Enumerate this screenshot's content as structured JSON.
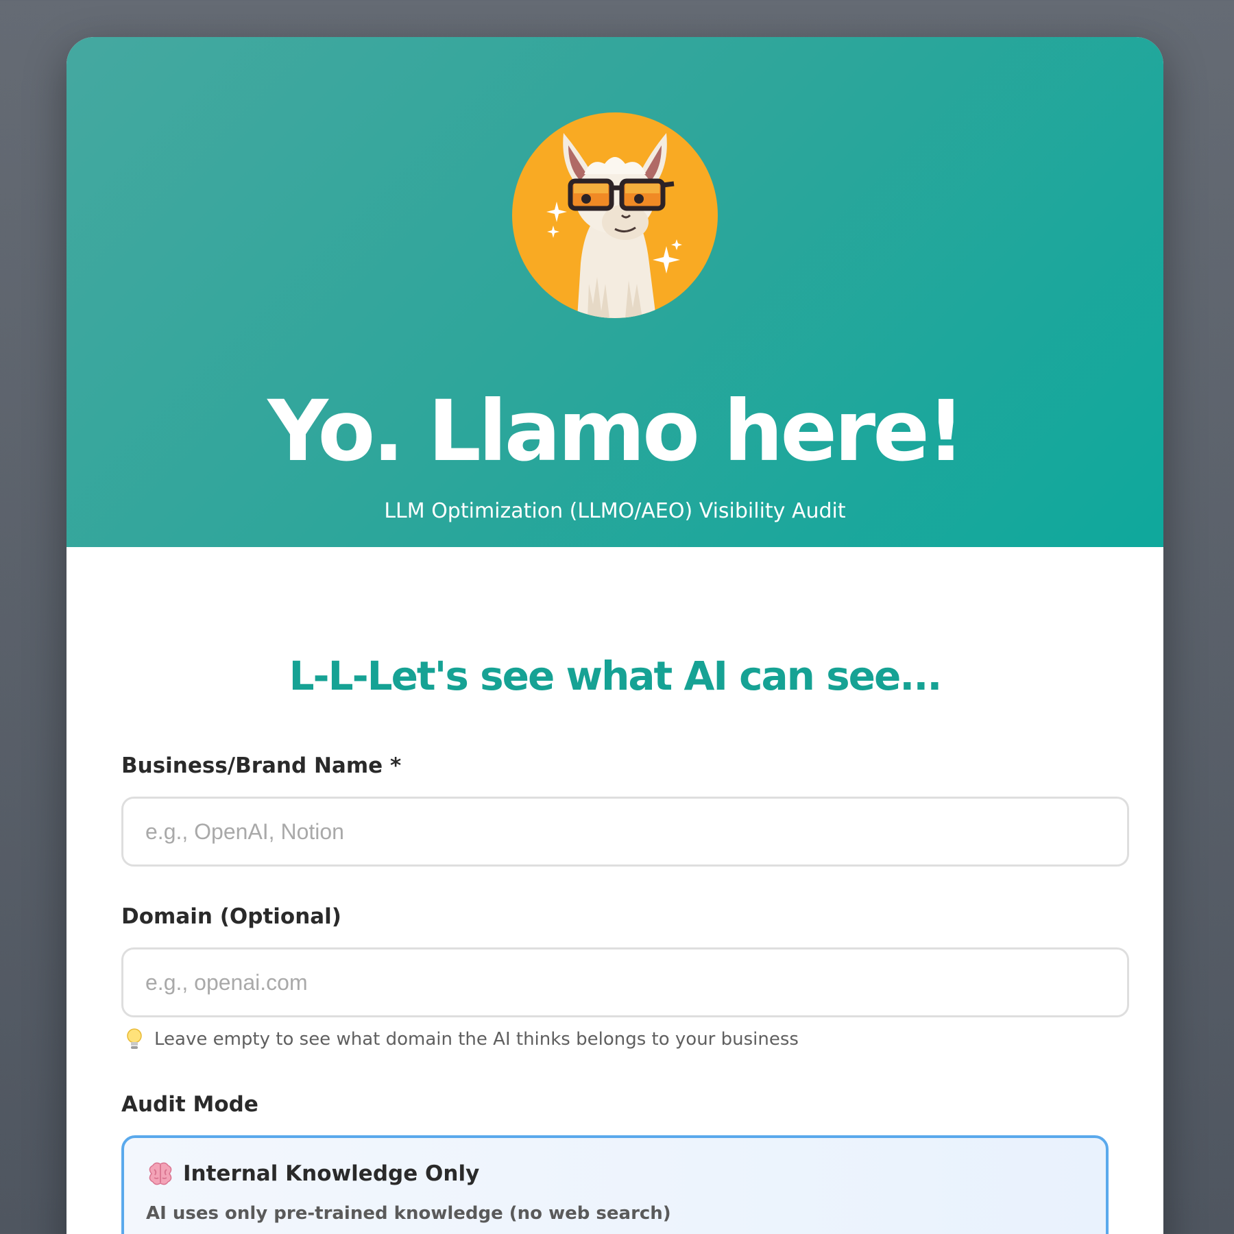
{
  "header": {
    "logo_icon": "llama-with-sunglasses-icon",
    "title": "Yo. Llamo here!",
    "subtitle": "LLM Optimization (LLMO/AEO) Visibility Audit"
  },
  "form": {
    "heading": "L-L-Let's see what AI can see...",
    "business_name": {
      "label": "Business/Brand Name *",
      "value": "",
      "placeholder": "e.g., OpenAI, Notion"
    },
    "domain": {
      "label": "Domain (Optional)",
      "value": "",
      "placeholder": "e.g., openai.com",
      "hint_icon": "lightbulb-icon",
      "hint": "Leave empty to see what domain the AI thinks belongs to your business"
    },
    "audit_mode": {
      "label": "Audit Mode",
      "selected_option": {
        "icon": "brain-icon",
        "title": "Internal Knowledge Only",
        "description": "AI uses only pre-trained knowledge (no web search)"
      }
    }
  },
  "colors": {
    "hero_gradient_start": "#45a8a0",
    "hero_gradient_end": "#0fa89c",
    "accent_teal": "#16a294",
    "logo_background": "#f9aa23",
    "selected_border": "#5aa9ec",
    "page_background": "#5b616a"
  }
}
